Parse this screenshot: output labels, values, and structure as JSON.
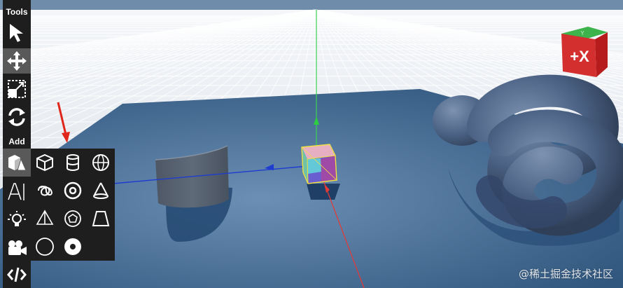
{
  "toolbar": {
    "tools_label": "Tools",
    "add_label": "Add",
    "tools": [
      {
        "name": "select-arrow-icon"
      },
      {
        "name": "move-icon"
      },
      {
        "name": "scale-icon"
      },
      {
        "name": "rotate-icon"
      }
    ],
    "add_items": [
      {
        "name": "primitives-icon"
      },
      {
        "name": "text-icon"
      },
      {
        "name": "light-bulb-icon"
      },
      {
        "name": "camera-icon"
      },
      {
        "name": "code-icon"
      }
    ]
  },
  "submenu": {
    "items": [
      "cube-icon",
      "cylinder-icon",
      "sphere-icon",
      "torus-knot-icon",
      "torus-icon",
      "cone-icon",
      "tetrahedron-icon",
      "dodecahedron-icon",
      "frustum-icon",
      "circle-icon",
      "ring-icon"
    ]
  },
  "view_cube": {
    "top_face": "Y",
    "front_face": "+X"
  },
  "watermark": "@稀土掘金技术社区",
  "colors": {
    "toolbar_bg": "#1e1e1e",
    "active_tool_bg": "#595959",
    "ground_plane": "#3f6892",
    "x_axis": "#e53935",
    "y_axis": "#2ecc40",
    "z_axis": "#1e3ccf",
    "selection": "#f0e040"
  }
}
